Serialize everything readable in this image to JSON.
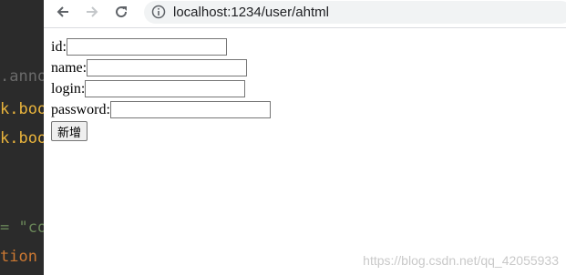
{
  "editor": {
    "lines": [
      {
        "text": ".anno",
        "color": "#6a6a6a"
      },
      {
        "text": "k.boo",
        "color": "#e8b33c"
      },
      {
        "text": "k.boo",
        "color": "#e8b33c"
      },
      {
        "text": "= \"co",
        "color": "#6a8759"
      },
      {
        "text": "tion ",
        "color": "#cc7832"
      }
    ]
  },
  "browser": {
    "url": "localhost:1234/user/ahtml",
    "icons": {
      "back": "arrow-left-icon",
      "forward": "arrow-right-icon",
      "reload": "reload-icon",
      "info": "info-circle-icon"
    }
  },
  "form": {
    "fields": [
      {
        "label": "id:",
        "value": ""
      },
      {
        "label": "name:",
        "value": ""
      },
      {
        "label": "login:",
        "value": ""
      },
      {
        "label": "password:",
        "value": ""
      }
    ],
    "submit_label": "新增"
  },
  "watermark": "https://blog.csdn.net/qq_42055933"
}
